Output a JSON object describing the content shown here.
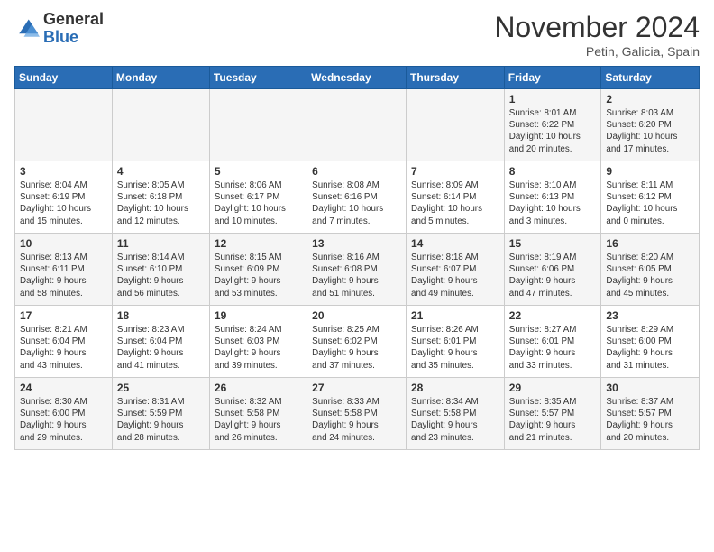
{
  "header": {
    "logo_general": "General",
    "logo_blue": "Blue",
    "month_title": "November 2024",
    "location": "Petin, Galicia, Spain"
  },
  "weekdays": [
    "Sunday",
    "Monday",
    "Tuesday",
    "Wednesday",
    "Thursday",
    "Friday",
    "Saturday"
  ],
  "rows": [
    [
      {
        "day": "",
        "info": ""
      },
      {
        "day": "",
        "info": ""
      },
      {
        "day": "",
        "info": ""
      },
      {
        "day": "",
        "info": ""
      },
      {
        "day": "",
        "info": ""
      },
      {
        "day": "1",
        "info": "Sunrise: 8:01 AM\nSunset: 6:22 PM\nDaylight: 10 hours\nand 20 minutes."
      },
      {
        "day": "2",
        "info": "Sunrise: 8:03 AM\nSunset: 6:20 PM\nDaylight: 10 hours\nand 17 minutes."
      }
    ],
    [
      {
        "day": "3",
        "info": "Sunrise: 8:04 AM\nSunset: 6:19 PM\nDaylight: 10 hours\nand 15 minutes."
      },
      {
        "day": "4",
        "info": "Sunrise: 8:05 AM\nSunset: 6:18 PM\nDaylight: 10 hours\nand 12 minutes."
      },
      {
        "day": "5",
        "info": "Sunrise: 8:06 AM\nSunset: 6:17 PM\nDaylight: 10 hours\nand 10 minutes."
      },
      {
        "day": "6",
        "info": "Sunrise: 8:08 AM\nSunset: 6:16 PM\nDaylight: 10 hours\nand 7 minutes."
      },
      {
        "day": "7",
        "info": "Sunrise: 8:09 AM\nSunset: 6:14 PM\nDaylight: 10 hours\nand 5 minutes."
      },
      {
        "day": "8",
        "info": "Sunrise: 8:10 AM\nSunset: 6:13 PM\nDaylight: 10 hours\nand 3 minutes."
      },
      {
        "day": "9",
        "info": "Sunrise: 8:11 AM\nSunset: 6:12 PM\nDaylight: 10 hours\nand 0 minutes."
      }
    ],
    [
      {
        "day": "10",
        "info": "Sunrise: 8:13 AM\nSunset: 6:11 PM\nDaylight: 9 hours\nand 58 minutes."
      },
      {
        "day": "11",
        "info": "Sunrise: 8:14 AM\nSunset: 6:10 PM\nDaylight: 9 hours\nand 56 minutes."
      },
      {
        "day": "12",
        "info": "Sunrise: 8:15 AM\nSunset: 6:09 PM\nDaylight: 9 hours\nand 53 minutes."
      },
      {
        "day": "13",
        "info": "Sunrise: 8:16 AM\nSunset: 6:08 PM\nDaylight: 9 hours\nand 51 minutes."
      },
      {
        "day": "14",
        "info": "Sunrise: 8:18 AM\nSunset: 6:07 PM\nDaylight: 9 hours\nand 49 minutes."
      },
      {
        "day": "15",
        "info": "Sunrise: 8:19 AM\nSunset: 6:06 PM\nDaylight: 9 hours\nand 47 minutes."
      },
      {
        "day": "16",
        "info": "Sunrise: 8:20 AM\nSunset: 6:05 PM\nDaylight: 9 hours\nand 45 minutes."
      }
    ],
    [
      {
        "day": "17",
        "info": "Sunrise: 8:21 AM\nSunset: 6:04 PM\nDaylight: 9 hours\nand 43 minutes."
      },
      {
        "day": "18",
        "info": "Sunrise: 8:23 AM\nSunset: 6:04 PM\nDaylight: 9 hours\nand 41 minutes."
      },
      {
        "day": "19",
        "info": "Sunrise: 8:24 AM\nSunset: 6:03 PM\nDaylight: 9 hours\nand 39 minutes."
      },
      {
        "day": "20",
        "info": "Sunrise: 8:25 AM\nSunset: 6:02 PM\nDaylight: 9 hours\nand 37 minutes."
      },
      {
        "day": "21",
        "info": "Sunrise: 8:26 AM\nSunset: 6:01 PM\nDaylight: 9 hours\nand 35 minutes."
      },
      {
        "day": "22",
        "info": "Sunrise: 8:27 AM\nSunset: 6:01 PM\nDaylight: 9 hours\nand 33 minutes."
      },
      {
        "day": "23",
        "info": "Sunrise: 8:29 AM\nSunset: 6:00 PM\nDaylight: 9 hours\nand 31 minutes."
      }
    ],
    [
      {
        "day": "24",
        "info": "Sunrise: 8:30 AM\nSunset: 6:00 PM\nDaylight: 9 hours\nand 29 minutes."
      },
      {
        "day": "25",
        "info": "Sunrise: 8:31 AM\nSunset: 5:59 PM\nDaylight: 9 hours\nand 28 minutes."
      },
      {
        "day": "26",
        "info": "Sunrise: 8:32 AM\nSunset: 5:58 PM\nDaylight: 9 hours\nand 26 minutes."
      },
      {
        "day": "27",
        "info": "Sunrise: 8:33 AM\nSunset: 5:58 PM\nDaylight: 9 hours\nand 24 minutes."
      },
      {
        "day": "28",
        "info": "Sunrise: 8:34 AM\nSunset: 5:58 PM\nDaylight: 9 hours\nand 23 minutes."
      },
      {
        "day": "29",
        "info": "Sunrise: 8:35 AM\nSunset: 5:57 PM\nDaylight: 9 hours\nand 21 minutes."
      },
      {
        "day": "30",
        "info": "Sunrise: 8:37 AM\nSunset: 5:57 PM\nDaylight: 9 hours\nand 20 minutes."
      }
    ]
  ]
}
